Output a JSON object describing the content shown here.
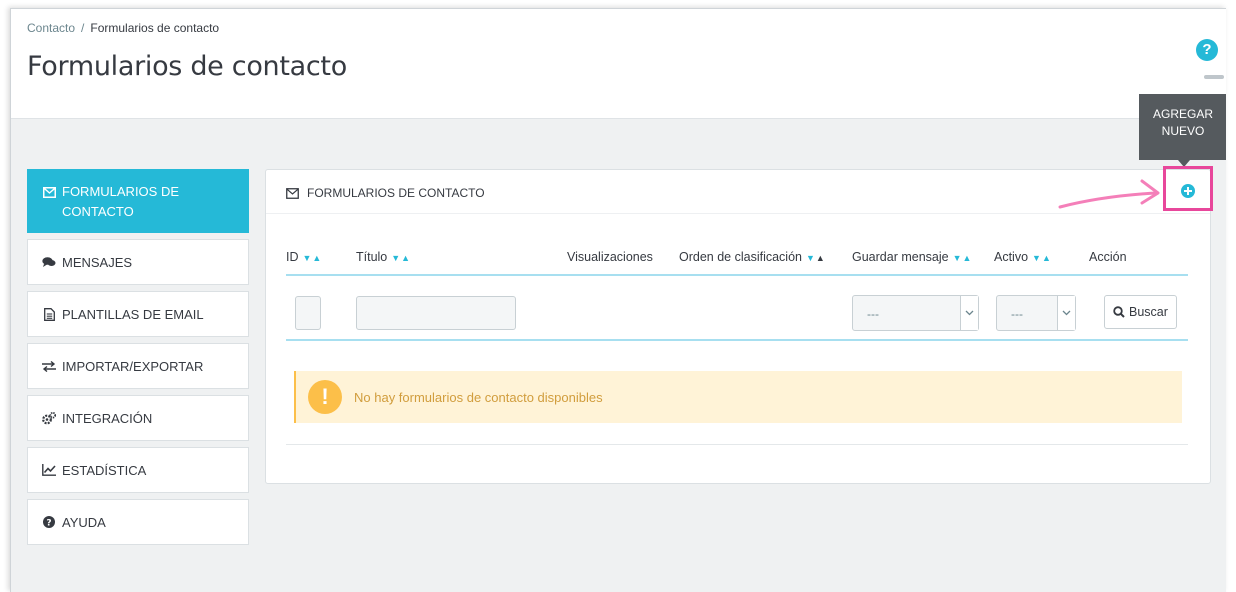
{
  "breadcrumb": {
    "parent": "Contacto",
    "separator": "/",
    "current": "Formularios de contacto"
  },
  "page_title": "Formularios de contacto",
  "help": {
    "glyph": "?"
  },
  "tooltip": {
    "line1": "AGREGAR",
    "line2": "NUEVO"
  },
  "sidebar": {
    "items": [
      {
        "line1": "FORMULARIOS DE",
        "line2": "CONTACTO",
        "icon": "envelope-icon",
        "active": true
      },
      {
        "label": "MENSAJES",
        "icon": "comments-icon"
      },
      {
        "label": "PLANTILLAS DE EMAIL",
        "icon": "file-icon"
      },
      {
        "label": "IMPORTAR/EXPORTAR",
        "icon": "exchange-icon"
      },
      {
        "label": "INTEGRACIÓN",
        "icon": "cogs-icon"
      },
      {
        "label": "ESTADÍSTICA",
        "icon": "line-chart-icon"
      },
      {
        "label": "AYUDA",
        "icon": "question-circle-icon"
      }
    ]
  },
  "panel": {
    "title": "FORMULARIOS DE CONTACTO",
    "columns": [
      "ID",
      "Título",
      "Visualizaciones",
      "Orden de clasificación",
      "Guardar mensaje",
      "Activo",
      "Acción"
    ],
    "filters": {
      "guardar_mensaje": "---",
      "activo": "---",
      "search_label": "Buscar"
    },
    "empty_message": "No hay formularios de contacto disponibles"
  },
  "colors": {
    "accent": "#25b9d7",
    "highlight": "#e8479b",
    "warning_bg": "#fff3d7",
    "warning_icon": "#fcbf49"
  }
}
